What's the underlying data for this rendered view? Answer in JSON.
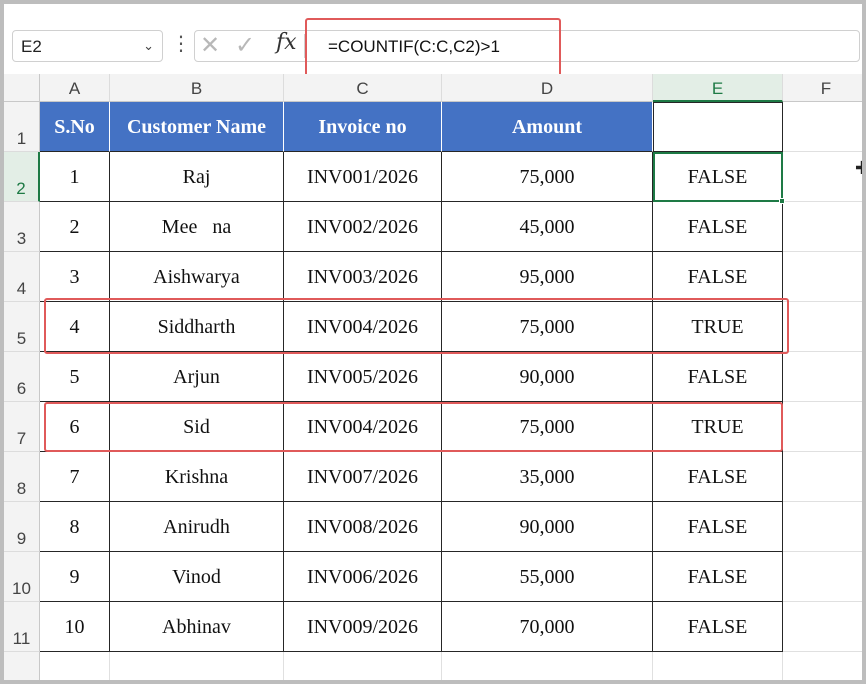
{
  "formula_bar": {
    "name_box": "E2",
    "cancel_icon": "✕",
    "enter_icon": "✓",
    "fx_label": "fx",
    "formula": "=COUNTIF(C:C,C2)>1"
  },
  "columns": [
    "A",
    "B",
    "C",
    "D",
    "E",
    "F"
  ],
  "rows": [
    "1",
    "2",
    "3",
    "4",
    "5",
    "6",
    "7",
    "8",
    "9",
    "10",
    "11"
  ],
  "table": {
    "headers": [
      "S.No",
      "Customer Name",
      "Invoice no",
      "Amount",
      ""
    ],
    "data": [
      [
        "1",
        "Raj",
        "INV001/2026",
        "75,000",
        "FALSE"
      ],
      [
        "2",
        "Mee   na",
        "INV002/2026",
        "45,000",
        "FALSE"
      ],
      [
        "3",
        "Aishwarya",
        "INV003/2026",
        "95,000",
        "FALSE"
      ],
      [
        "4",
        "Siddharth",
        "INV004/2026",
        "75,000",
        "TRUE"
      ],
      [
        "5",
        "Arjun",
        "INV005/2026",
        "90,000",
        "FALSE"
      ],
      [
        "6",
        "Sid",
        "INV004/2026",
        "75,000",
        "TRUE"
      ],
      [
        "7",
        "Krishna",
        "INV007/2026",
        "35,000",
        "FALSE"
      ],
      [
        "8",
        "Anirudh",
        "INV008/2026",
        "90,000",
        "FALSE"
      ],
      [
        "9",
        "Vinod",
        "INV006/2026",
        "55,000",
        "FALSE"
      ],
      [
        "10",
        "Abhinav",
        "INV009/2026",
        "70,000",
        "FALSE"
      ]
    ]
  },
  "selection": {
    "active_cell": "E2",
    "active_column": "E",
    "active_row": "2"
  },
  "highlighted_rows": [
    "5",
    "7"
  ],
  "colors": {
    "header_fill": "#4472c4",
    "header_text": "#ffffff",
    "selection_green": "#1e7a45",
    "annotation_red": "#e05a5a"
  }
}
